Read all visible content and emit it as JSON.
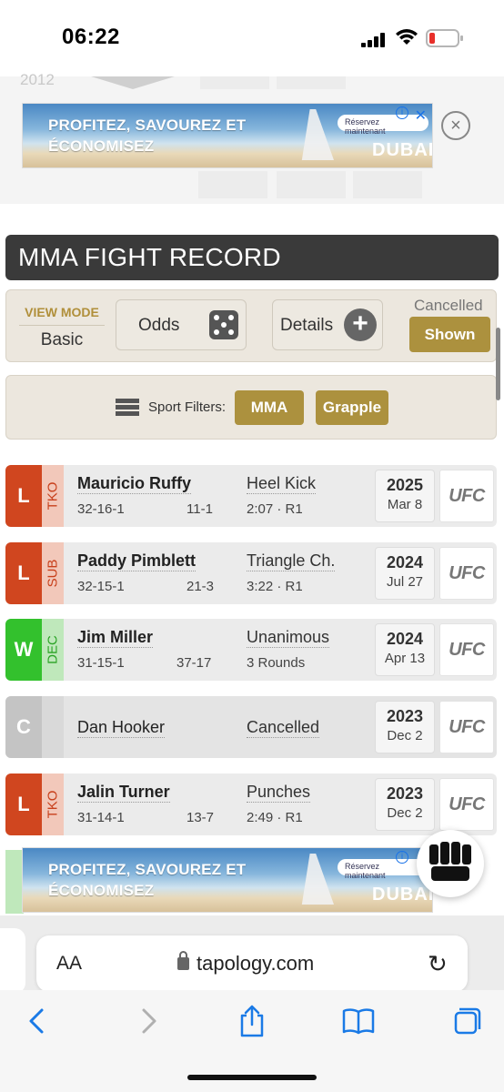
{
  "status_bar": {
    "time": "06:22"
  },
  "ghost": {
    "year": "2012"
  },
  "ads": {
    "headline": "PROFITEZ, SAVOUREZ ET ÉCONOMISEZ",
    "cta": "Réservez maintenant",
    "brand": "DUBAI"
  },
  "section": {
    "title": "MMA FIGHT RECORD"
  },
  "view_mode": {
    "label": "VIEW MODE",
    "value": "Basic",
    "odds_label": "Odds",
    "details_label": "Details",
    "cancelled_label": "Cancelled",
    "cancelled_state": "Shown"
  },
  "filters": {
    "label": "Sport Filters:",
    "options": [
      "MMA",
      "Grapple"
    ]
  },
  "fights": [
    {
      "result": "L",
      "method": "TKO",
      "opponent": "Mauricio Ruffy",
      "opponent_record": "32-16-1",
      "opp_record_at": "11-1",
      "finish": "Heel Kick",
      "time": "2:07 · R1",
      "year": "2025",
      "date": "Mar 8",
      "promotion": "UFC"
    },
    {
      "result": "L",
      "method": "SUB",
      "opponent": "Paddy Pimblett",
      "opponent_record": "32-15-1",
      "opp_record_at": "21-3",
      "finish": "Triangle Ch.",
      "time": "3:22 · R1",
      "year": "2024",
      "date": "Jul 27",
      "promotion": "UFC"
    },
    {
      "result": "W",
      "method": "DEC",
      "opponent": "Jim Miller",
      "opponent_record": "31-15-1",
      "opp_record_at": "37-17",
      "finish": "Unanimous",
      "time": "3 Rounds",
      "year": "2024",
      "date": "Apr 13",
      "promotion": "UFC"
    },
    {
      "result": "C",
      "method": "",
      "opponent": "Dan Hooker",
      "opponent_record": "",
      "opp_record_at": "",
      "finish": "Cancelled",
      "time": "",
      "year": "2023",
      "date": "Dec 2",
      "promotion": "UFC"
    },
    {
      "result": "L",
      "method": "TKO",
      "opponent": "Jalin Turner",
      "opponent_record": "31-14-1",
      "opp_record_at": "13-7",
      "finish": "Punches",
      "time": "2:49 · R1",
      "year": "2023",
      "date": "Dec 2",
      "promotion": "UFC"
    }
  ],
  "browser": {
    "aa_label": "AA",
    "url": "tapology.com"
  },
  "colors": {
    "loss": "#d0461f",
    "loss_method_bg": "#f2c8ba",
    "win": "#33c12d",
    "win_method_bg": "#bfe8bb",
    "cancelled": "#c4c4c4",
    "gold": "#ac913e",
    "ios_blue": "#1a7ae6"
  }
}
